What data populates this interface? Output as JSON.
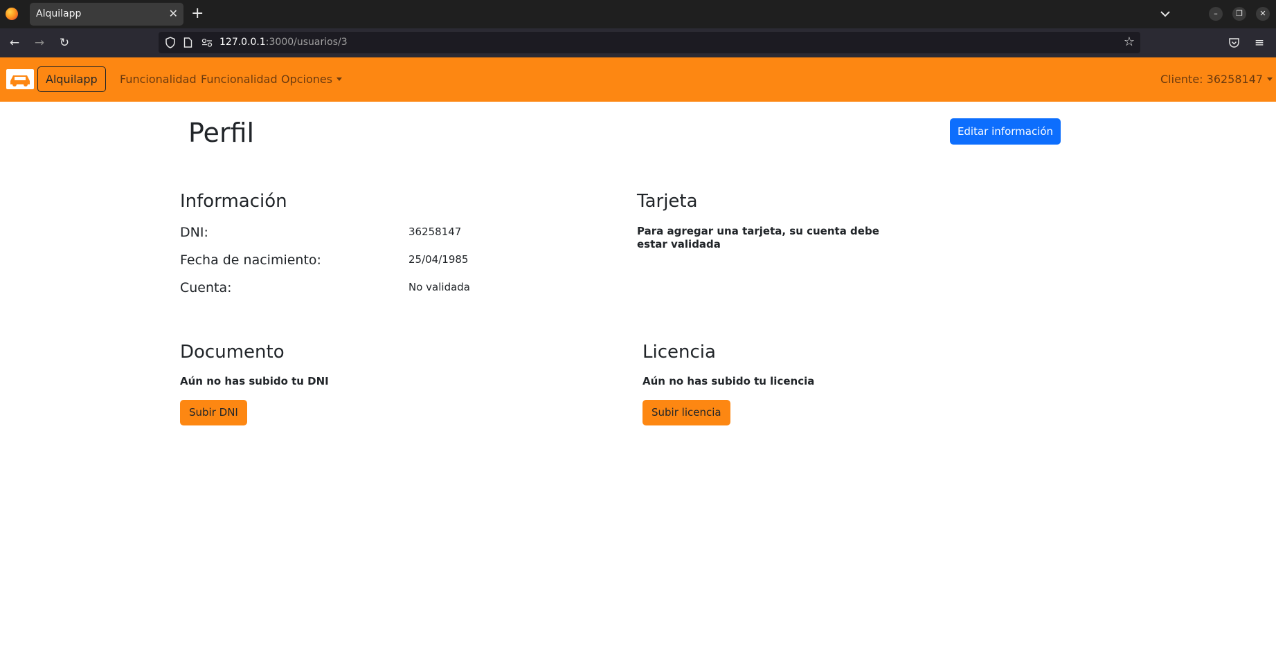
{
  "browser": {
    "tab_title": "Alquilapp",
    "url_host": "127.0.0.1",
    "url_path": ":3000/usuarios/3"
  },
  "navbar": {
    "brand": "Alquilapp",
    "links": [
      "Funcionalidad",
      "Funcionalidad",
      "Opciones"
    ],
    "user_menu": "Cliente: 36258147"
  },
  "page": {
    "title": "Perfil",
    "edit_button": "Editar información"
  },
  "informacion": {
    "heading": "Información",
    "rows": [
      {
        "label": "DNI:",
        "value": "36258147"
      },
      {
        "label": "Fecha de nacimiento:",
        "value": "25/04/1985"
      },
      {
        "label": "Cuenta:",
        "value": "No validada"
      }
    ]
  },
  "tarjeta": {
    "heading": "Tarjeta",
    "message_line1": "Para agregar una tarjeta, su cuenta debe",
    "message_line2": "estar validada"
  },
  "documento": {
    "heading": "Documento",
    "message": "Aún no has subido tu DNI",
    "button": "Subir DNI"
  },
  "licencia": {
    "heading": "Licencia",
    "message": "Aún no has subido tu licencia",
    "button": "Subir licencia"
  },
  "colors": {
    "navbar_orange": "#fd8712",
    "primary_blue": "#0d6efd"
  }
}
